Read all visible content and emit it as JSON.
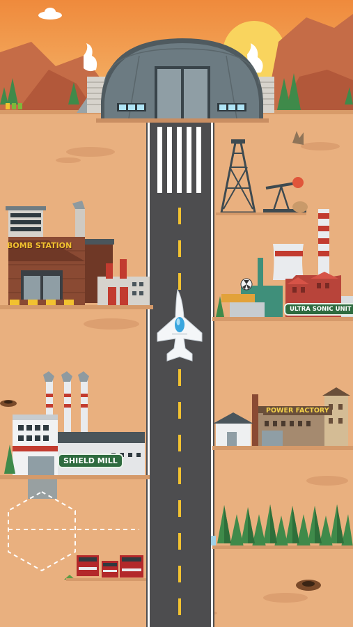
{
  "buildings": {
    "bomb_station": {
      "label": "BOMB STATION"
    },
    "ultra_sonic_unit": {
      "label": "ULTRA SONIC UNIT"
    },
    "shield_mill": {
      "label": "SHIELD MILL"
    },
    "power_factory": {
      "label": "POWER FACTORY"
    }
  },
  "colors": {
    "sky_top": "#f0903f",
    "sky_bottom": "#f7b96a",
    "ground": "#e9b07f",
    "runway": "#4d4d4f",
    "runway_dash": "#f2c230",
    "sign_green": "#2e6b3f",
    "brick": "#8a4a33",
    "hangar": "#6c7b82"
  }
}
